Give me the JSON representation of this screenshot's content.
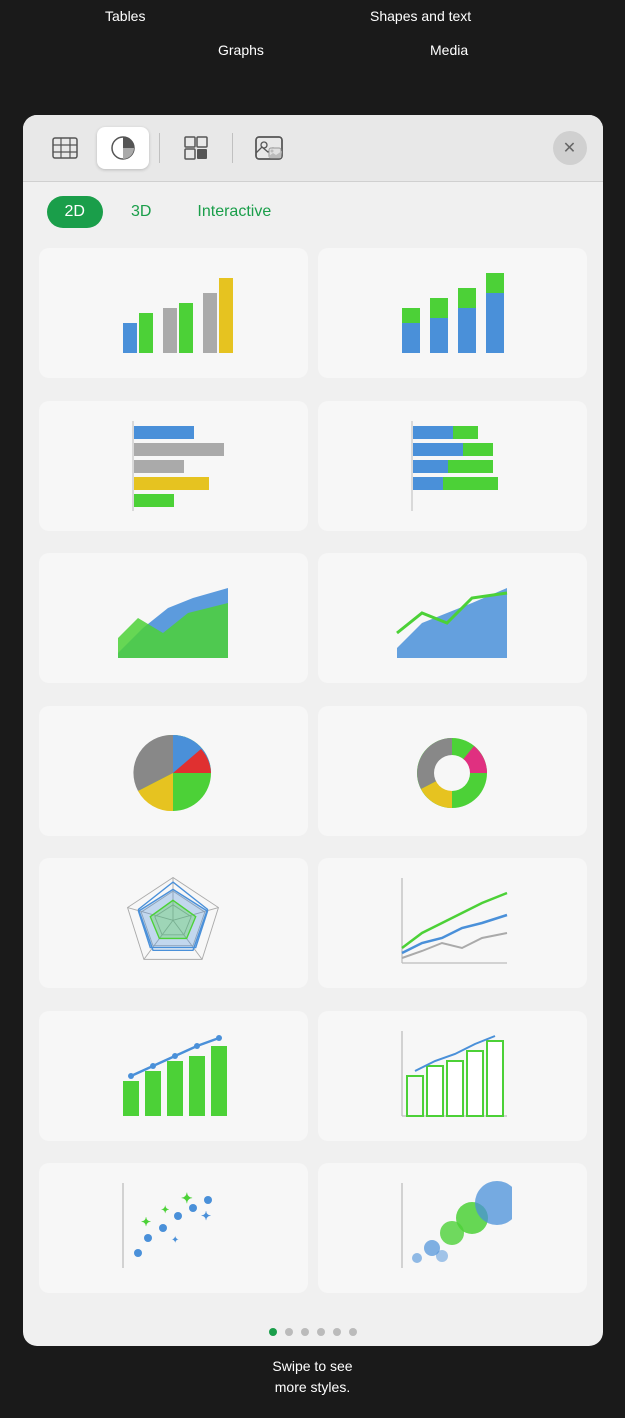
{
  "annotations": {
    "tables": "Tables",
    "graphs": "Graphs",
    "shapes_text": "Shapes and text",
    "media": "Media"
  },
  "toolbar": {
    "buttons": [
      {
        "id": "tables",
        "icon": "⊞",
        "label": "Tables"
      },
      {
        "id": "graphs",
        "icon": "◑",
        "label": "Graphs",
        "active": true
      },
      {
        "id": "shapes",
        "icon": "◫",
        "label": "Shapes"
      },
      {
        "id": "media",
        "icon": "▣",
        "label": "Media"
      }
    ],
    "close_label": "✕"
  },
  "tabs": [
    {
      "id": "2d",
      "label": "2D",
      "active": true
    },
    {
      "id": "3d",
      "label": "3D",
      "active": false
    },
    {
      "id": "interactive",
      "label": "Interactive",
      "active": false
    }
  ],
  "charts": [
    {
      "id": "grouped-bar",
      "type": "grouped-bar"
    },
    {
      "id": "stacked-bar",
      "type": "stacked-bar"
    },
    {
      "id": "horizontal-bar",
      "type": "horizontal-bar"
    },
    {
      "id": "stacked-horizontal-bar",
      "type": "stacked-horizontal-bar"
    },
    {
      "id": "area",
      "type": "area"
    },
    {
      "id": "line-area",
      "type": "line-area"
    },
    {
      "id": "pie",
      "type": "pie"
    },
    {
      "id": "donut",
      "type": "donut"
    },
    {
      "id": "radar",
      "type": "radar"
    },
    {
      "id": "line",
      "type": "line"
    },
    {
      "id": "mixed-bar-line",
      "type": "mixed-bar-line"
    },
    {
      "id": "bar-outline",
      "type": "bar-outline"
    },
    {
      "id": "scatter",
      "type": "scatter"
    },
    {
      "id": "bubble",
      "type": "bubble"
    }
  ],
  "page_dots": [
    true,
    false,
    false,
    false,
    false,
    false
  ],
  "bottom_annotation": "Swipe to see\nmore styles."
}
